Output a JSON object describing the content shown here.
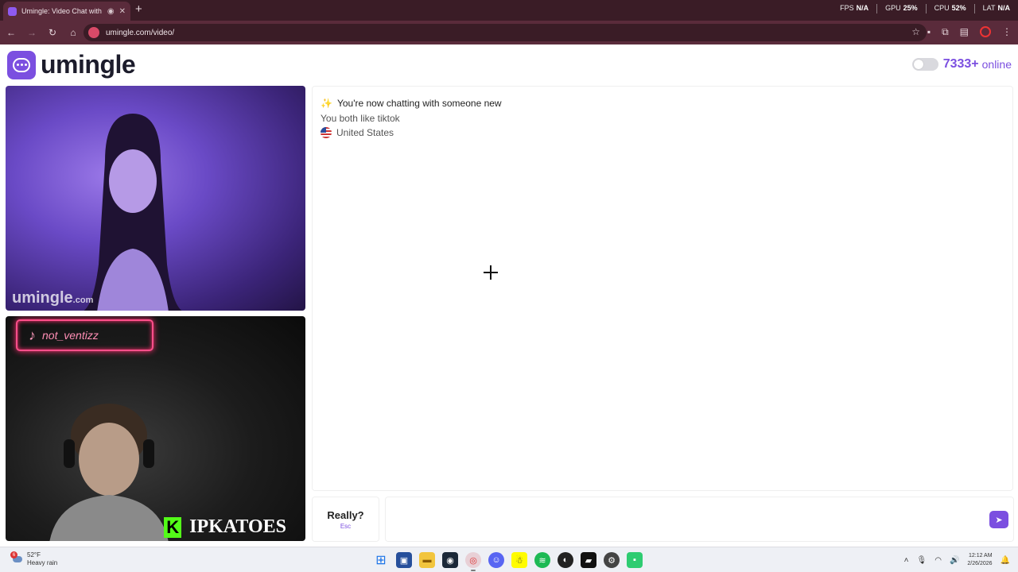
{
  "browser": {
    "tab_title": "Umingle: Video Chat with S",
    "new_tab_symbol": "+",
    "url": "umingle.com/video/",
    "hud": {
      "fps_label": "FPS",
      "fps_value": "N/A",
      "gpu_label": "GPU",
      "gpu_value": "25%",
      "cpu_label": "CPU",
      "cpu_value": "52%",
      "lat_label": "LAT",
      "lat_value": "N/A"
    }
  },
  "header": {
    "logo_text": "umingle",
    "online_count": "7333+",
    "online_label": "online"
  },
  "videos": {
    "remote_watermark": "umingle",
    "remote_watermark_suffix": ".com",
    "local_sign_text": "not_ventizz",
    "local_streamer_tag": "IPKATOES",
    "local_streamer_badge": "K"
  },
  "chat": {
    "system_line": "You're now chatting with someone new",
    "shared_interest": "You both like tiktok",
    "country": "United States"
  },
  "composer": {
    "skip_label": "Really?",
    "skip_hint": "Esc",
    "message_placeholder": ""
  },
  "taskbar": {
    "weather_temp": "52°F",
    "weather_desc": "Heavy rain",
    "weather_badge": "6",
    "time": "12:12 AM",
    "date": "2/26/2026"
  },
  "colors": {
    "brand": "#7b4fe0",
    "chrome_dark": "#3a1c26",
    "chrome_mid": "#5a2b3b"
  }
}
